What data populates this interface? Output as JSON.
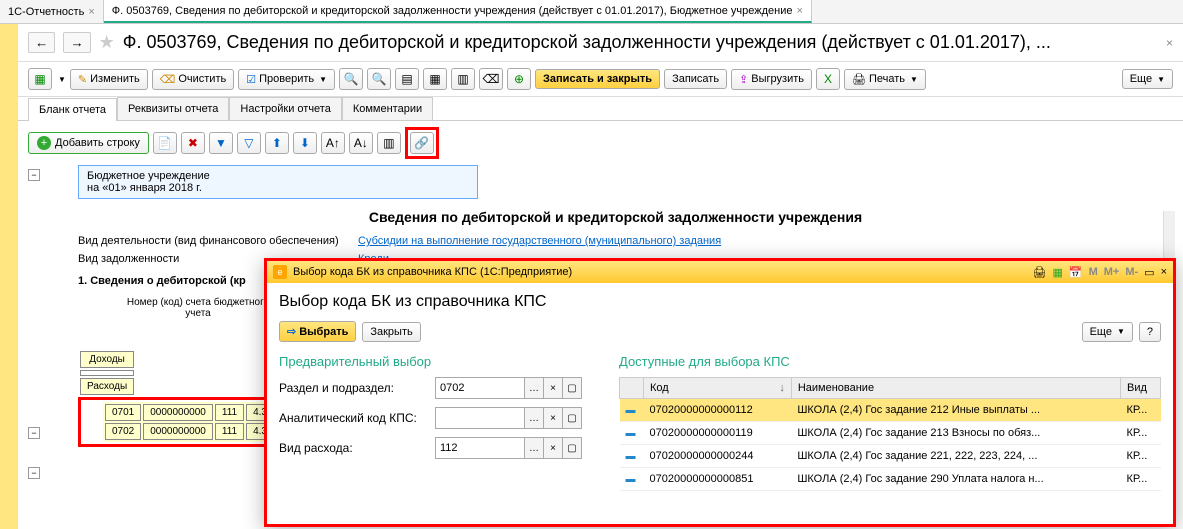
{
  "tabs": [
    {
      "label": "1С-Отчетность"
    },
    {
      "label": "Ф. 0503769, Сведения по дебиторской и кредиторской задолженности учреждения (действует с 01.01.2017), Бюджетное учреждение"
    }
  ],
  "page_title": "Ф. 0503769, Сведения по дебиторской и кредиторской задолженности учреждения (действует с 01.01.2017), ...",
  "toolbar1": {
    "edit": "Изменить",
    "clear": "Очистить",
    "check": "Проверить",
    "save_close": "Записать и закрыть",
    "save": "Записать",
    "export": "Выгрузить",
    "print": "Печать",
    "more": "Еще"
  },
  "tabs2": [
    "Бланк отчета",
    "Реквизиты отчета",
    "Настройки отчета",
    "Комментарии"
  ],
  "toolbar2": {
    "add_row": "Добавить строку"
  },
  "doc": {
    "org_type": "Бюджетное учреждение",
    "date_line": "на «01» января 2018 г.",
    "title": "Сведения по дебиторской и кредиторской задолженности учреждения",
    "activity_label": "Вид деятельности (вид финансового обеспечения)",
    "activity_value": "Субсидии на выполнение государственного (муниципального) задания",
    "debt_type_label": "Вид задолженности",
    "debt_type_value": "Креди",
    "section1": "1. Сведения о дебиторской (кр",
    "col_header": "Номер (код) счета бюджетного учета",
    "rows": {
      "income": "Доходы",
      "expense": "Расходы"
    },
    "data_rows": [
      {
        "c1": "0701",
        "c2": "0000000000",
        "c3": "111",
        "c4": "4.3"
      },
      {
        "c1": "0702",
        "c2": "0000000000",
        "c3": "111",
        "c4": "4.3"
      }
    ]
  },
  "dialog": {
    "window_title": "Выбор кода БК из справочника КПС (1С:Предприятие)",
    "title": "Выбор кода БК из справочника КПС",
    "select_btn": "Выбрать",
    "close_btn": "Закрыть",
    "more_btn": "Еще",
    "left_title": "Предварительный выбор",
    "right_title": "Доступные для выбора КПС",
    "fields": {
      "section_label": "Раздел и подраздел:",
      "section_value": "0702",
      "analytic_label": "Аналитический код КПС:",
      "analytic_value": "",
      "expense_label": "Вид расхода:",
      "expense_value": "112"
    },
    "cols": {
      "code": "Код",
      "name": "Наименование",
      "type": "Вид"
    },
    "rows": [
      {
        "code": "07020000000000112",
        "name": "ШКОЛА (2,4) Гос задание 212 Иные выплаты ...",
        "type": "КР..."
      },
      {
        "code": "07020000000000119",
        "name": "ШКОЛА (2,4) Гос задание 213 Взносы по обяз...",
        "type": "КР..."
      },
      {
        "code": "07020000000000244",
        "name": "ШКОЛА (2,4) Гос задание 221, 222, 223, 224, ...",
        "type": "КР..."
      },
      {
        "code": "07020000000000851",
        "name": "ШКОЛА (2,4) Гос задание 290 Уплата налога н...",
        "type": "КР..."
      }
    ]
  }
}
